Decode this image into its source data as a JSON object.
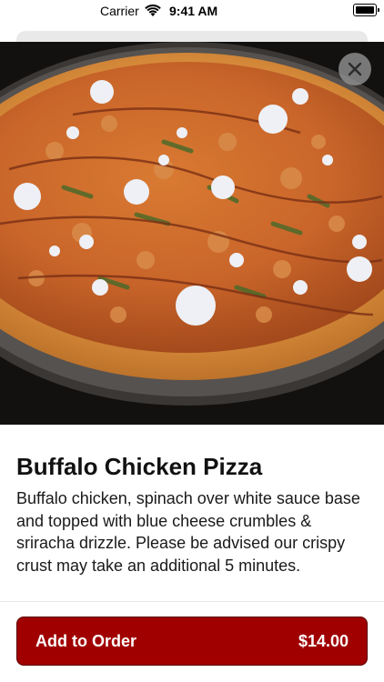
{
  "status_bar": {
    "carrier": "Carrier",
    "time": "9:41 AM"
  },
  "item": {
    "image_alt": "Buffalo Chicken Pizza photo",
    "title": "Buffalo Chicken Pizza",
    "description": "Buffalo chicken, spinach over white sauce base and topped with blue cheese crumbles & sriracha drizzle. Please be advised our crispy crust may take an additional 5 minutes."
  },
  "action": {
    "label": "Add to Order",
    "price": "$14.00"
  },
  "colors": {
    "button_bg": "#a00000",
    "button_text": "#ffffff",
    "close_bg": "#969696"
  },
  "icons": {
    "close": "close-icon",
    "wifi": "wifi-icon",
    "battery": "battery-icon"
  }
}
